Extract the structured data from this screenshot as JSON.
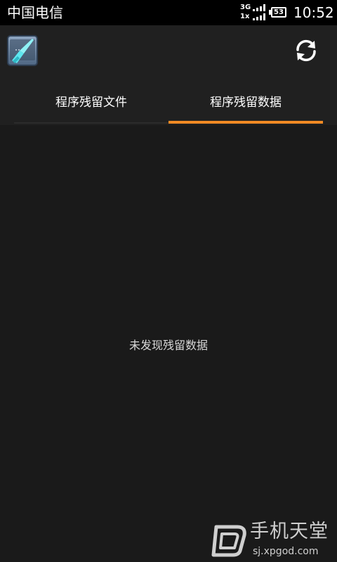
{
  "status_bar": {
    "carrier": "中国电信",
    "network_top": "3G",
    "network_bottom": "1x",
    "battery": "53",
    "time": "10:52"
  },
  "action_bar": {
    "app_icon": "broom-icon",
    "refresh_icon": "refresh-icon"
  },
  "tabs": [
    {
      "label": "程序残留文件",
      "selected": false
    },
    {
      "label": "程序残留数据",
      "selected": true
    }
  ],
  "content": {
    "empty_message": "未发现残留数据"
  },
  "watermark": {
    "title": "手机天堂",
    "url": "sj.xpgod.com"
  },
  "colors": {
    "accent": "#f08a24",
    "background": "#1a1a1a",
    "bar": "#202020"
  }
}
